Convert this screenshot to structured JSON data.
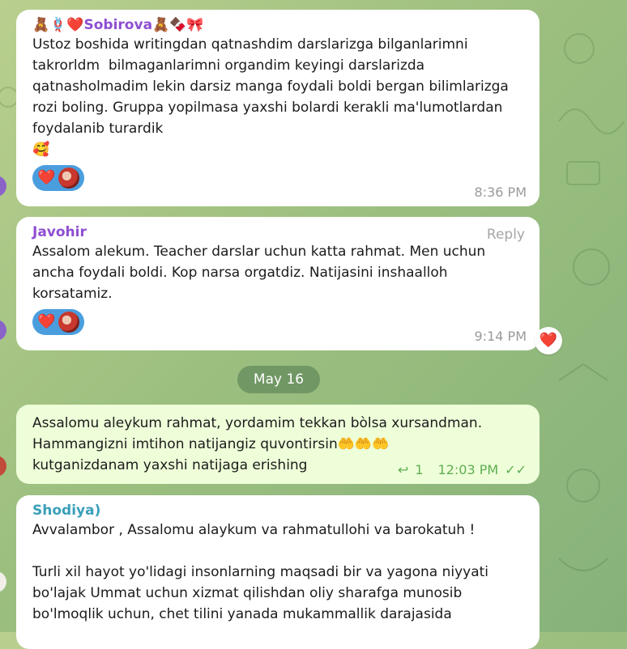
{
  "messages": [
    {
      "sender_name": "🧸🪢❤️Sobirova🧸🍫🎀",
      "sender_color": "#8e4fd1",
      "text": "Ustoz boshida writingdan qatnashdim darslarizga bilganlarimni takrorldm  bilmaganlarimni organdim keyingi darslarizda qatnasholmadim lekin darsiz manga foydali boldi bergan bilimlarizga rozi boling. Gruppa yopilmasa yaxshi bolardi kerakli ma'lumotlardan foydalanib turardik\n🥰",
      "reaction": "❤️",
      "time": "8:36 PM"
    },
    {
      "sender_name": "Javohir",
      "sender_color": "#8e4fd1",
      "reply_label": "Reply",
      "text": "Assalom alekum. Teacher darslar uchun katta rahmat. Men uchun ancha foydali boldi. Kop narsa orgatdiz. Natijasini inshaalloh korsatamiz.",
      "reaction": "❤️",
      "time": "9:14 PM",
      "side_reaction": "❤️"
    },
    {
      "text": "Assalomu aleykum rahmat, yordamim tekkan bòlsa xursandman. Hammangizni imtihon natijangiz quvontirsin🤲🤲🤲\nkutganizdanam yaxshi natijaga erishing",
      "reply_count": "1",
      "time": "12:03 PM"
    },
    {
      "sender_name": "Shodiya)",
      "sender_color": "#3a9fba",
      "text": "Avvalambor , Assalomu alaykum va rahmatullohi va barokatuh !\n\nTurli xil hayot yo'lidagi insonlarning maqsadi bir va yagona niyyati bo'lajak Ummat uchun xizmat qilishdan oliy sharafga munosib bo'lmoqlik uchun, chet tilini yanada mukammallik darajasida"
    }
  ],
  "date_separator": "May 16"
}
